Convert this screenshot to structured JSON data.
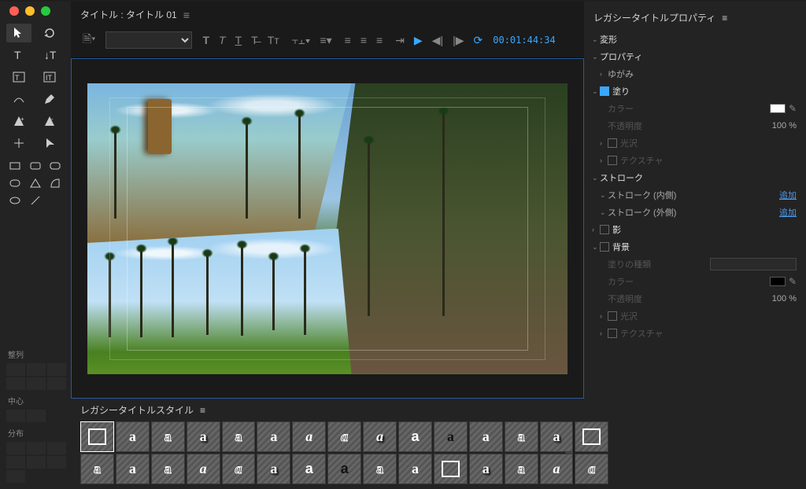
{
  "titleBar": {
    "label": "タイトル : タイトル 01"
  },
  "formatBar": {
    "timecode": "00:01:44:34"
  },
  "stylesPanel": {
    "title": "レガシータイトルスタイル"
  },
  "alignPanel": {
    "align": "整列",
    "center": "中心",
    "distribute": "分布"
  },
  "propsPanel": {
    "title": "レガシータイトルプロパティ",
    "transform": "変形",
    "properties": "プロパティ",
    "distort": "ゆがみ",
    "fill": "塗り",
    "color": "カラー",
    "colorValue": "#ffffff",
    "opacity": "不透明度",
    "opacityVal": "100 %",
    "sheen": "光沢",
    "texture": "テクスチャ",
    "stroke": "ストローク",
    "strokeInner": "ストローク (内側)",
    "strokeOuter": "ストローク (外側)",
    "add": "追加",
    "shadow": "影",
    "background": "背景",
    "fillType": "塗りの種類",
    "bgColor": "#000000",
    "bgOpacity": "100 %"
  }
}
